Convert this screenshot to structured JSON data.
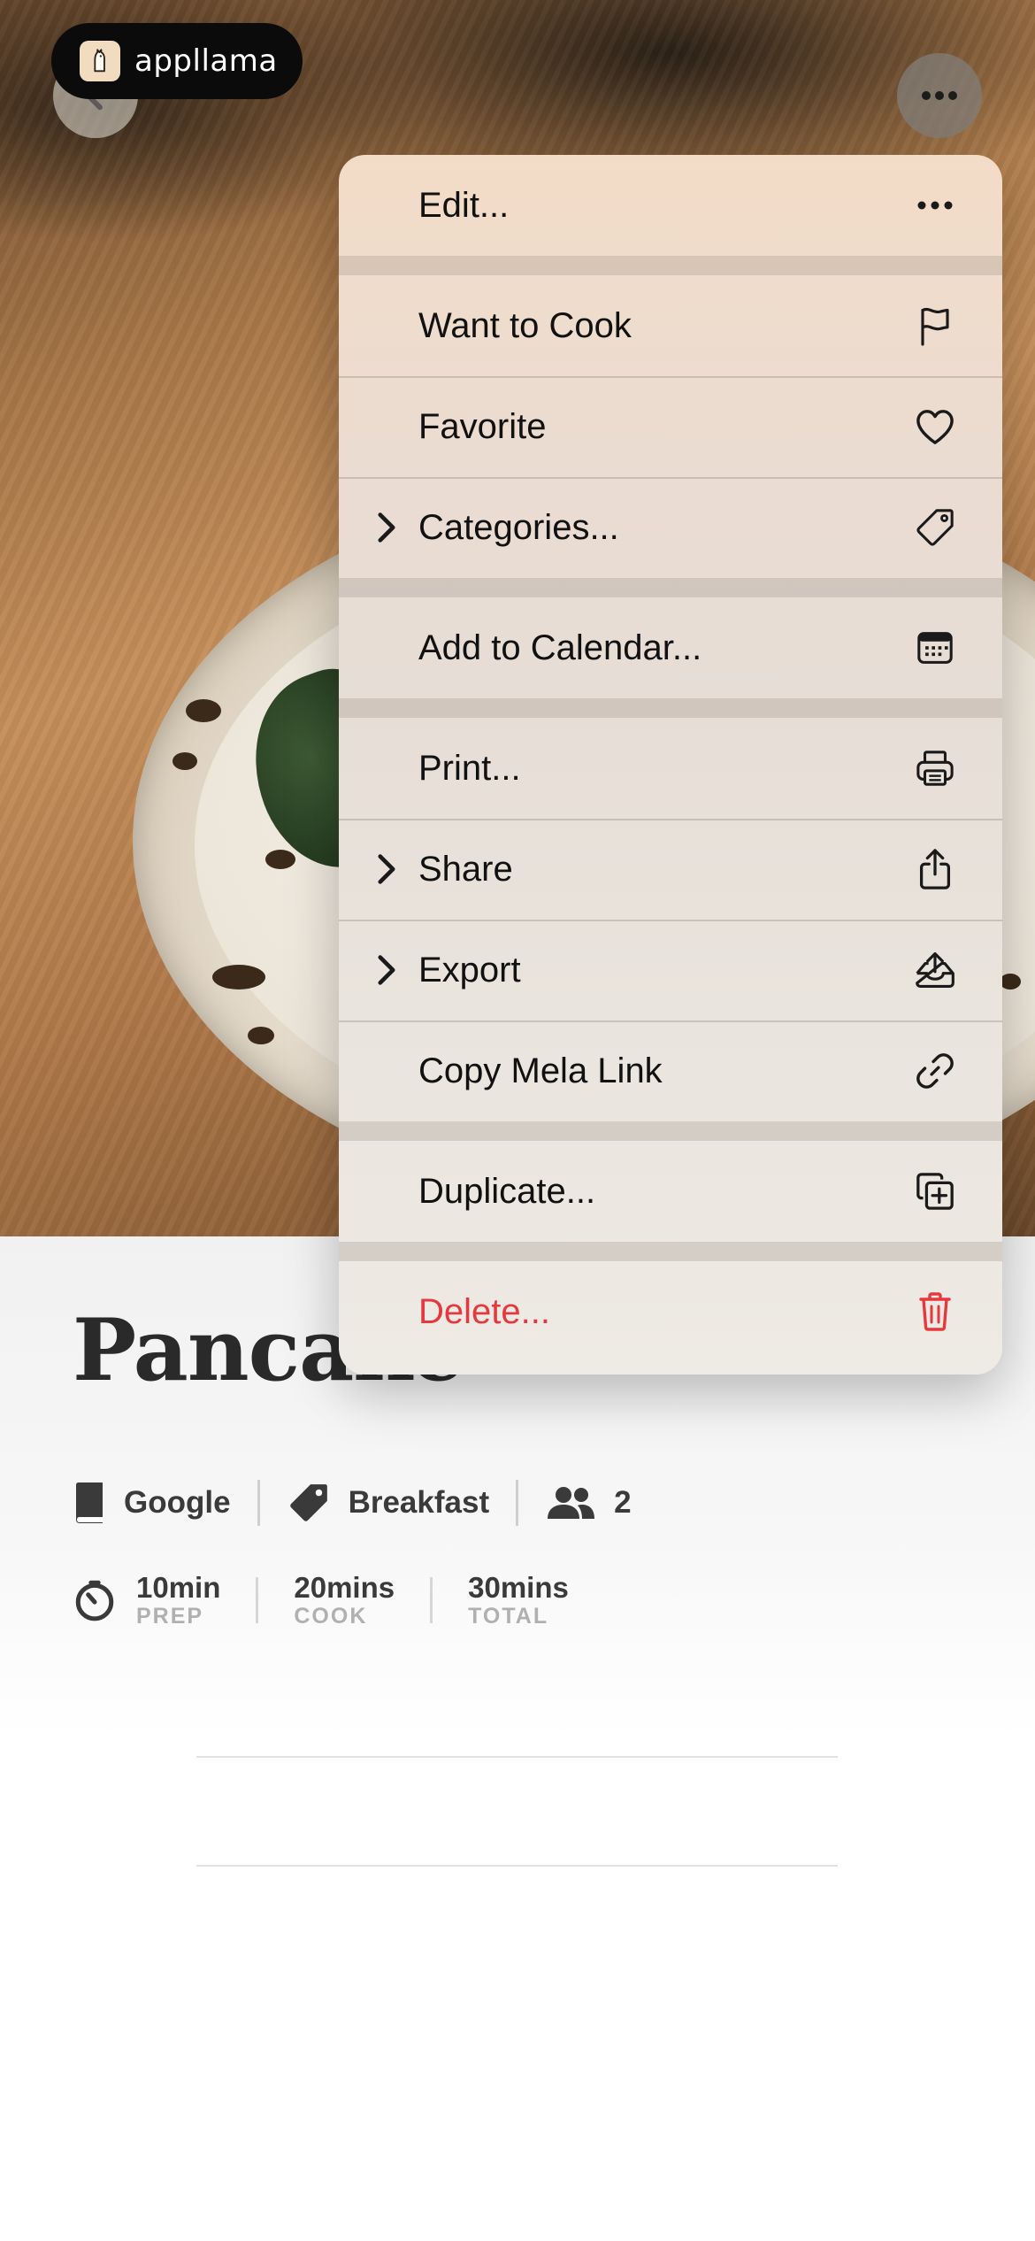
{
  "badge": {
    "text": "appllama"
  },
  "recipe": {
    "title": "Pancake",
    "source": "Google",
    "category": "Breakfast",
    "servings": "2",
    "times": [
      {
        "value": "10min",
        "label": "PREP"
      },
      {
        "value": "20mins",
        "label": "COOK"
      },
      {
        "value": "30mins",
        "label": "TOTAL"
      }
    ]
  },
  "menu": {
    "items": [
      {
        "label": "Edit...",
        "icon": "ellipsis-icon",
        "submenu": false
      },
      {
        "label": "Want to Cook",
        "icon": "flag-icon",
        "submenu": false
      },
      {
        "label": "Favorite",
        "icon": "heart-icon",
        "submenu": false
      },
      {
        "label": "Categories...",
        "icon": "tag-icon",
        "submenu": true
      },
      {
        "label": "Add to Calendar...",
        "icon": "calendar-icon",
        "submenu": false
      },
      {
        "label": "Print...",
        "icon": "printer-icon",
        "submenu": false
      },
      {
        "label": "Share",
        "icon": "share-icon",
        "submenu": true
      },
      {
        "label": "Export",
        "icon": "export-tray-icon",
        "submenu": true
      },
      {
        "label": "Copy Mela Link",
        "icon": "link-icon",
        "submenu": false
      },
      {
        "label": "Duplicate...",
        "icon": "duplicate-icon",
        "submenu": false
      },
      {
        "label": "Delete...",
        "icon": "trash-icon",
        "submenu": false,
        "destructive": true
      }
    ]
  },
  "colors": {
    "destructive": "#e5393f",
    "text": "#111111",
    "badge_bg": "#0b0b0b"
  }
}
